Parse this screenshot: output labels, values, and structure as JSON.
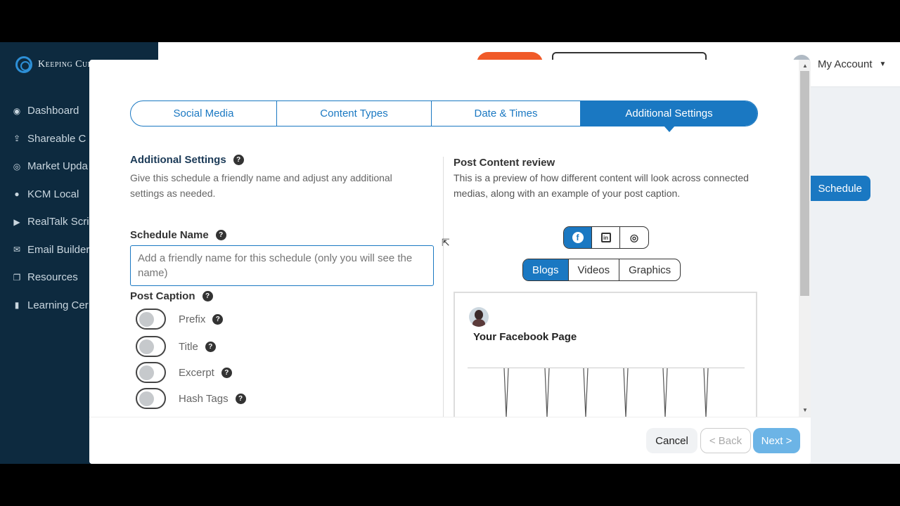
{
  "app": {
    "logo_text": "Keeping Curr",
    "sidebar": [
      {
        "label": "Dashboard",
        "icon": "dashboard-icon"
      },
      {
        "label": "Shareable C",
        "icon": "share-icon"
      },
      {
        "label": "Market Upda",
        "icon": "market-icon"
      },
      {
        "label": "KCM Local",
        "icon": "location-icon"
      },
      {
        "label": "RealTalk Scri",
        "icon": "play-icon"
      },
      {
        "label": "Email Builder",
        "icon": "email-icon"
      },
      {
        "label": "Resources",
        "icon": "resources-icon"
      },
      {
        "label": "Learning Cer",
        "icon": "book-icon"
      }
    ],
    "account_label": "My Account",
    "schedule_button": "Schedule"
  },
  "modal": {
    "tabs": [
      "Social Media",
      "Content Types",
      "Date & Times",
      "Additional Settings"
    ],
    "active_tab": 3,
    "additional": {
      "title": "Additional Settings",
      "description": "Give this schedule a friendly name and adjust any additional settings as needed."
    },
    "schedule_name": {
      "label": "Schedule Name",
      "placeholder": "Add a friendly name for this schedule (only you will see the name)"
    },
    "post_caption": {
      "label": "Post Caption",
      "toggles": [
        {
          "label": "Prefix",
          "on": false
        },
        {
          "label": "Title",
          "on": false
        },
        {
          "label": "Excerpt",
          "on": false
        },
        {
          "label": "Hash Tags",
          "on": false
        }
      ]
    },
    "review": {
      "title": "Post Content review",
      "description": "This is a preview of how different content will look across connected medias, along with an example of your post caption.",
      "social": [
        {
          "icon": "facebook-icon",
          "glyph": "f",
          "active": true
        },
        {
          "icon": "linkedin-icon",
          "glyph": "in",
          "active": false
        },
        {
          "icon": "instagram-icon",
          "glyph": "◎",
          "active": false
        }
      ],
      "content_types": [
        "Blogs",
        "Videos",
        "Graphics"
      ],
      "active_content_type": 0,
      "page_name": "Your Facebook Page"
    },
    "footer": {
      "cancel": "Cancel",
      "back": "< Back",
      "next": "Next >"
    }
  },
  "colors": {
    "accent": "#1a78c2",
    "sidebar_bg": "#0d2a3f",
    "next_disabled": "#6cb4e6"
  }
}
